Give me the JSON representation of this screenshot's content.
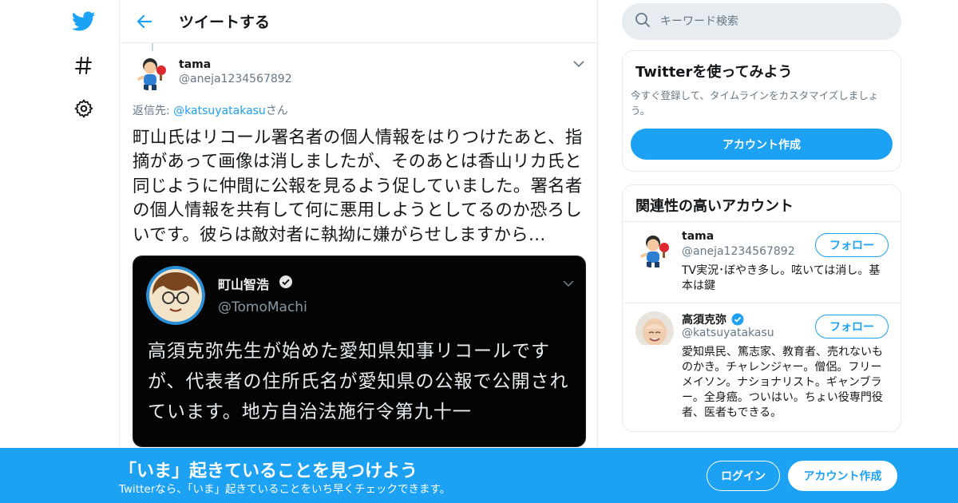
{
  "colors": {
    "brand": "#1da1f2",
    "border": "#e6ecf0",
    "muted": "#657786"
  },
  "nav": {
    "icons": [
      "twitter-logo-icon",
      "hashtag-icon",
      "gear-icon"
    ]
  },
  "header": {
    "title": "ツイートする",
    "back_icon": "arrow-left-icon"
  },
  "tweet": {
    "author_name": "tama",
    "author_handle": "@aneja1234567892",
    "reply_prefix": "返信先: ",
    "reply_mention": "@katsuyatakasu",
    "reply_suffix": "さん",
    "text": "町山氏はリコール署名者の個人情報をはりつけたあと、指摘があって画像は消しましたが、そのあとは香山リカ氏と同じように仲間に公報を見るよう促していました。署名者の個人情報を共有して何に悪用しようとしてるのか恐ろしいです。彼らは敵対者に執拗に嫌がらせしますから…",
    "media": {
      "name": "町山智浩",
      "handle": "@TomoMachi",
      "text": "高須克弥先生が始めた愛知県知事リコールですが、代表者の住所氏名が愛知県の公報で公開されています。地方自治法施行令第九十一"
    }
  },
  "search": {
    "placeholder": "キーワード検索"
  },
  "signup_card": {
    "title": "Twitterを使ってみよう",
    "description": "今すぐ登録して、タイムラインをカスタマイズしましょう。",
    "button": "アカウント作成"
  },
  "related": {
    "title": "関連性の高いアカウント",
    "accounts": [
      {
        "name": "tama",
        "handle": "@aneja1234567892",
        "bio": "TV実況･ぼやき多し。呟いては消し。基本は鍵",
        "follow": "フォロー",
        "verified": false
      },
      {
        "name": "高須克弥",
        "handle": "@katsuyatakasu",
        "bio": "愛知県民、篤志家、教育者、売れないものかき。チャレンジャー。僧侶。フリーメイソン。ナショナリスト。ギャンブラー。全身癌。ついはい。ちょい役専門役者、医者もできる。",
        "follow": "フォロー",
        "verified": true
      }
    ]
  },
  "banner": {
    "title": "「いま」起きていることを見つけよう",
    "subtitle": "Twitterなら、「いま」起きていることをいち早くチェックできます。",
    "login": "ログイン",
    "signup": "アカウント作成"
  }
}
